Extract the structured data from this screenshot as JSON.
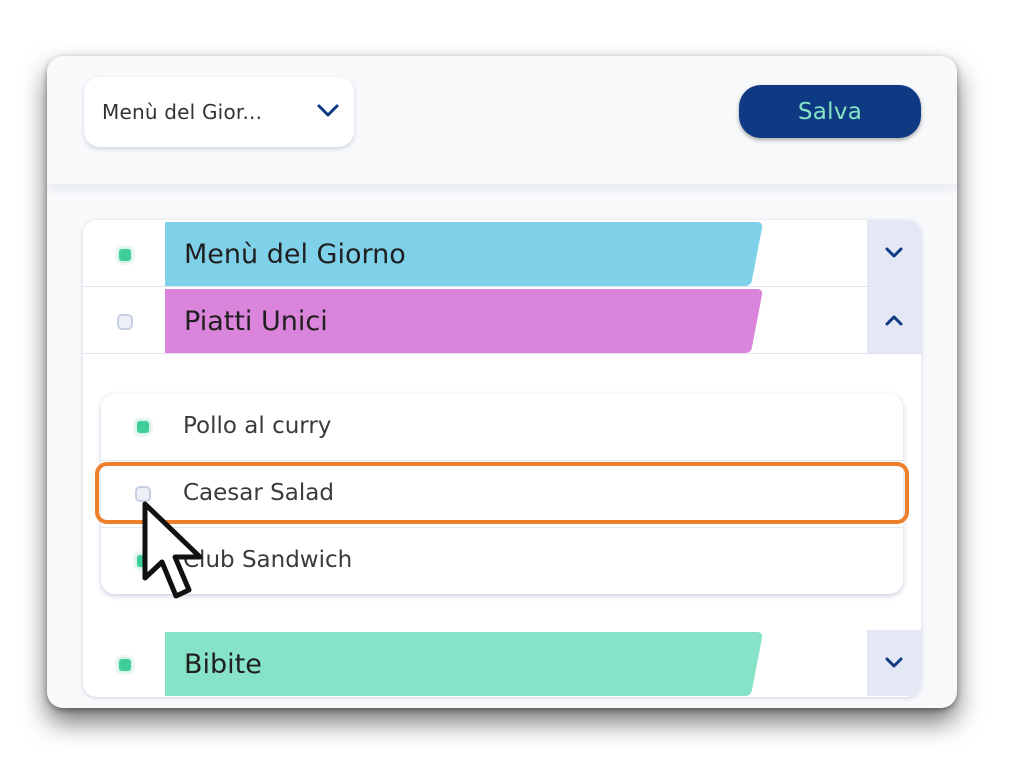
{
  "toolbar": {
    "dropdown_label": "Menù del Gior...",
    "save_label": "Salva"
  },
  "categories": [
    {
      "title": "Menù del Giorno",
      "checked": true,
      "expanded": false,
      "color": "#7fd1ea"
    },
    {
      "title": "Piatti Unici",
      "checked": false,
      "expanded": true,
      "color": "#da85db"
    },
    {
      "title": "Bibite",
      "checked": true,
      "expanded": false,
      "color": "#86e3c8"
    }
  ],
  "items": [
    {
      "label": "Pollo al curry",
      "checked": true
    },
    {
      "label": "Caesar Salad",
      "checked": false,
      "highlighted": true
    },
    {
      "label": "Club Sandwich",
      "checked": true
    }
  ],
  "colors": {
    "brand": "#0e3a84",
    "accent": "#86e3c4",
    "check_on": "#3fcd9a",
    "highlight": "#ee7f2d"
  },
  "icons": {
    "dropdown": "chevron-down-icon",
    "collapsed": "chevron-down-icon",
    "expanded": "chevron-up-icon",
    "pointer": "mouse-pointer-icon"
  }
}
